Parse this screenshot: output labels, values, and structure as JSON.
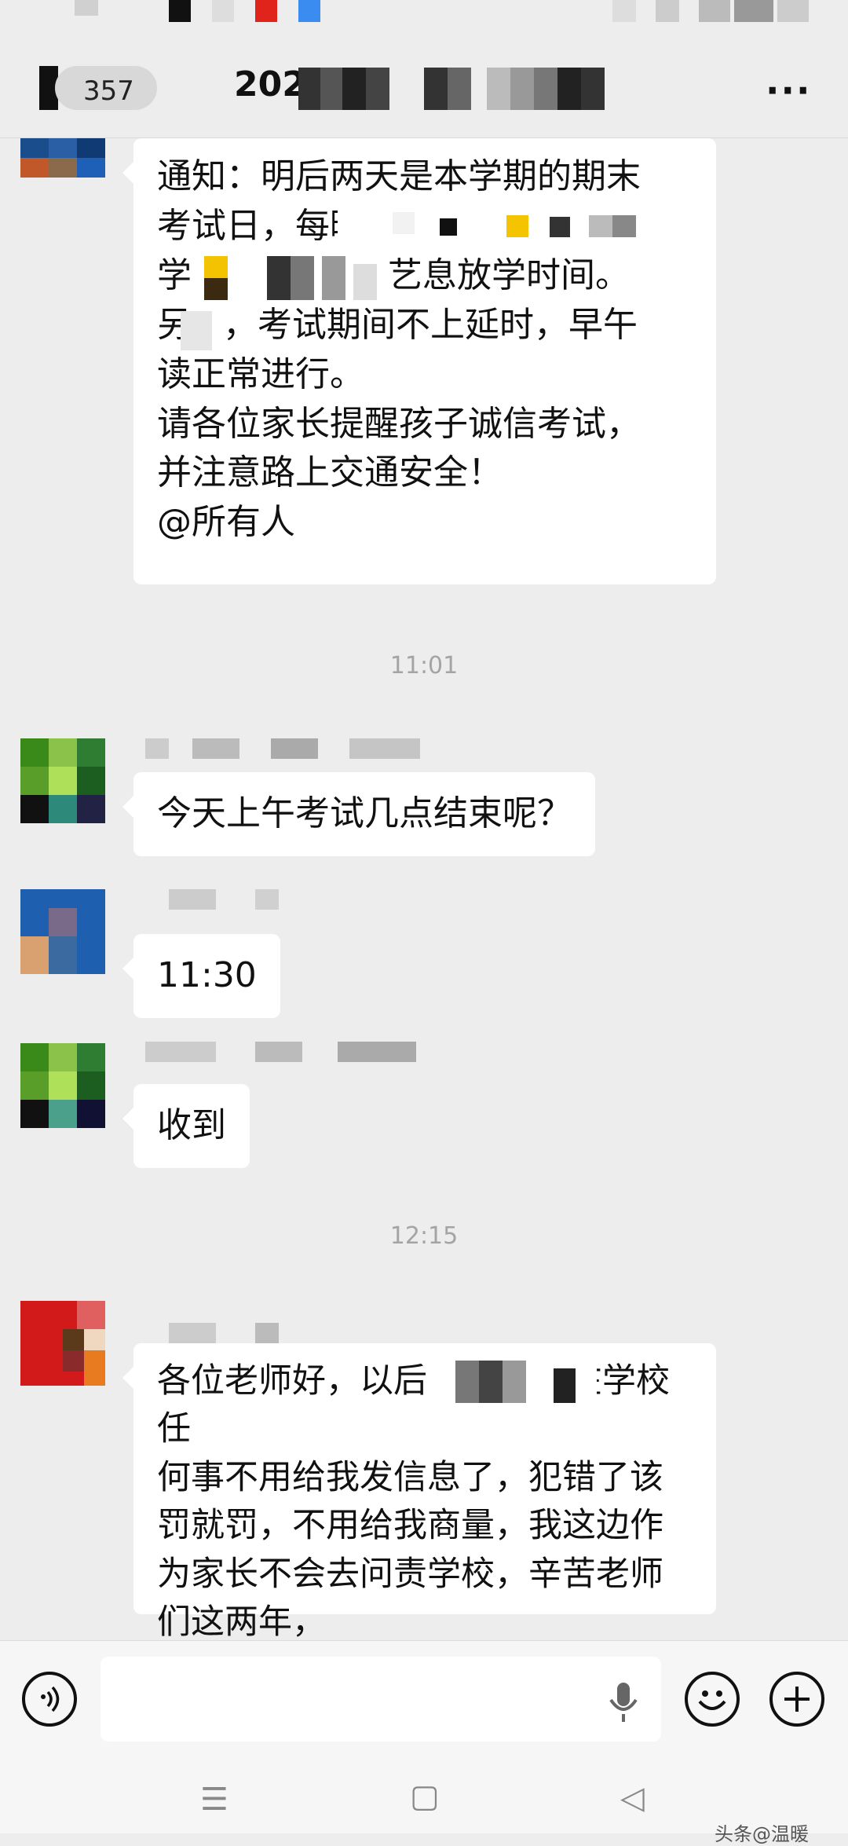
{
  "header": {
    "back_count": "357",
    "title": "202",
    "more_label": "···"
  },
  "messages": [
    {
      "lines": [
        "通知：明后两天是本学期的期末",
        "考试日，每晌",
        "学",
        "另",
        "读正常进行。",
        "请各位家长提醒孩子诚信考试，",
        "并注意路上交通安全！",
        "@所有人"
      ],
      "line3_suffix": "艺息放学时间。",
      "line4_suffix": "，考试期间不上延时，早午"
    },
    {
      "time": "11:01"
    },
    {
      "text": "今天上午考试几点结束呢？"
    },
    {
      "text": "11:30"
    },
    {
      "text": "收到"
    },
    {
      "time": "12:15"
    },
    {
      "lines": [
        "各位老师好，以后",
        "何事不用给我发信息了，犯错了该",
        "罚就罚，不用给我商量，我这边作",
        "为家长不会去问责学校，辛苦老师",
        "们这两年，"
      ],
      "line1_suffix": "在学校任"
    }
  ],
  "input": {
    "voice_icon": "voice-icon",
    "mic_icon": "microphone-icon",
    "emoji_icon": "emoji-icon",
    "plus_icon": "plus-icon"
  },
  "nav": {
    "menu": "☰",
    "home": "▢",
    "back": "◁"
  },
  "watermark": "头条@温暖",
  "colors": {
    "background": "#ededed",
    "bubble": "#ffffff",
    "time_text": "#a4a4a4"
  }
}
